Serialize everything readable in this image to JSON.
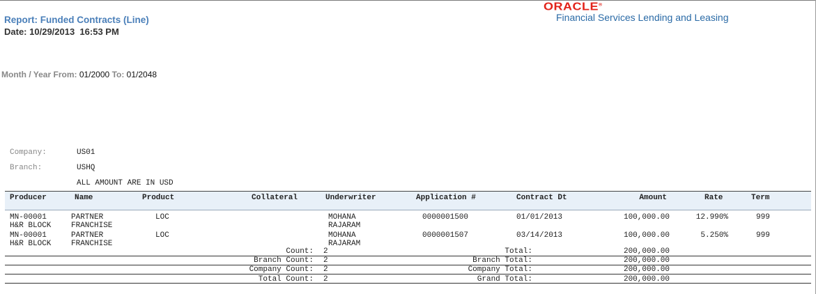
{
  "report": {
    "title": "Report: Funded Contracts (Line)",
    "date_label": "Date:",
    "date_value": "10/29/2013  16:53 PM"
  },
  "brand": {
    "logo_text": "ORACLE",
    "logo_mark": "®",
    "subtitle": "Financial Services Lending and Leasing",
    "logo_color": "#e2231a",
    "subtitle_color": "#2a6aa6"
  },
  "period": {
    "label": "Month / Year",
    "from_label": "From:",
    "from_value": "01/2000",
    "to_label": "To:",
    "to_value": "01/2048"
  },
  "info": {
    "company_label": "Company:",
    "company_value": "US01",
    "branch_label": "Branch:",
    "branch_value": "USHQ",
    "currency_note": "ALL AMOUNT ARE IN USD"
  },
  "table": {
    "headers": {
      "producer": "Producer",
      "name": "Name",
      "product": "Product",
      "collateral": "Collateral",
      "underwriter": "Underwriter",
      "application": "Application #",
      "contract_dt": "Contract Dt",
      "amount": "Amount",
      "rate": "Rate",
      "term": "Term"
    },
    "rows": [
      {
        "producer_1": "MN-00001",
        "producer_2": "H&R BLOCK",
        "name_1": "PARTNER",
        "name_2": "FRANCHISE",
        "product": "LOC",
        "collateral": "",
        "underwriter_1": "MOHANA",
        "underwriter_2": "RAJARAM",
        "application": "0000001500",
        "contract_dt": "01/01/2013",
        "amount": "100,000.00",
        "rate": "12.990%",
        "term": "999"
      },
      {
        "producer_1": "MN-00001",
        "producer_2": "H&R BLOCK",
        "name_1": "PARTNER",
        "name_2": "FRANCHISE",
        "product": "LOC",
        "collateral": "",
        "underwriter_1": "MOHANA",
        "underwriter_2": "RAJARAM",
        "application": "0000001507",
        "contract_dt": "03/14/2013",
        "amount": "100,000.00",
        "rate": "5.250%",
        "term": "999"
      }
    ],
    "totals": [
      {
        "count_label": "Count:",
        "count": "2",
        "total_label": "Total:",
        "total": "200,000.00"
      },
      {
        "count_label": "Branch Count:",
        "count": "2",
        "total_label": "Branch Total:",
        "total": "200,000.00"
      },
      {
        "count_label": "Company Count:",
        "count": "2",
        "total_label": "Company Total:",
        "total": "200,000.00"
      },
      {
        "count_label": "Total Count:",
        "count": "2",
        "total_label": "Grand Total:",
        "total": "200,000.00"
      }
    ]
  }
}
